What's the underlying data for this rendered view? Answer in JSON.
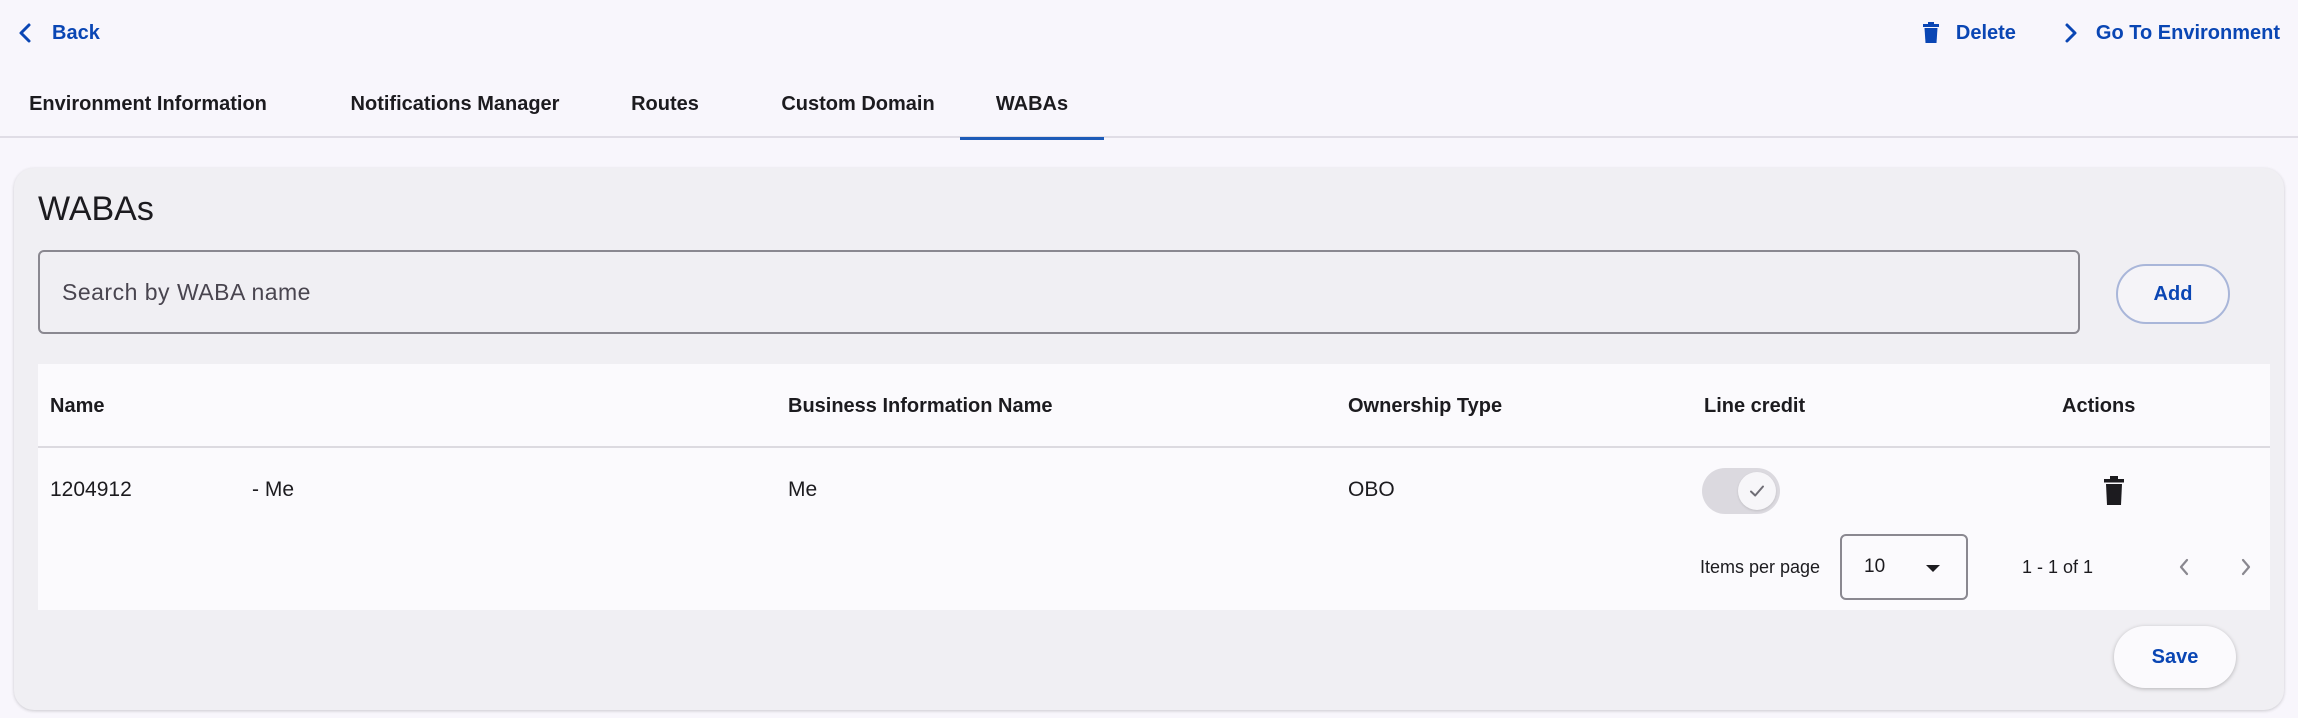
{
  "header": {
    "back_label": "Back",
    "delete_label": "Delete",
    "go_to_environment_label": "Go To Environment"
  },
  "tabs": [
    {
      "label": "Environment Information"
    },
    {
      "label": "Notifications Manager"
    },
    {
      "label": "Routes"
    },
    {
      "label": "Custom Domain"
    },
    {
      "label": "WABAs",
      "active": true
    }
  ],
  "card": {
    "title": "WABAs",
    "search_placeholder": "Search by WABA name",
    "add_label": "Add",
    "save_label": "Save"
  },
  "table": {
    "columns": [
      "Name",
      "Business Information Name",
      "Ownership Type",
      "Line credit",
      "Actions"
    ],
    "rows": [
      {
        "name_id": "1204912",
        "name_suffix": "- Me",
        "business_information_name": "Me",
        "ownership_type": "OBO",
        "line_credit": true
      }
    ]
  },
  "paginator": {
    "items_per_page_label": "Items per page",
    "items_per_page_value": "10",
    "range_label": "1 - 1 of 1"
  },
  "colors": {
    "accent": "#0a46b4",
    "tab_indicator": "#1d5bb8",
    "background": "#f8f6fc",
    "card": "#f0eff3"
  },
  "icons": {
    "back": "chevron-left-icon",
    "delete": "trash-icon",
    "go_to_environment": "chevron-right-icon",
    "toggle_check": "check-icon",
    "row_delete": "trash-icon",
    "dropdown": "caret-down-icon",
    "prev_page": "chevron-left-icon",
    "next_page": "chevron-right-icon"
  }
}
